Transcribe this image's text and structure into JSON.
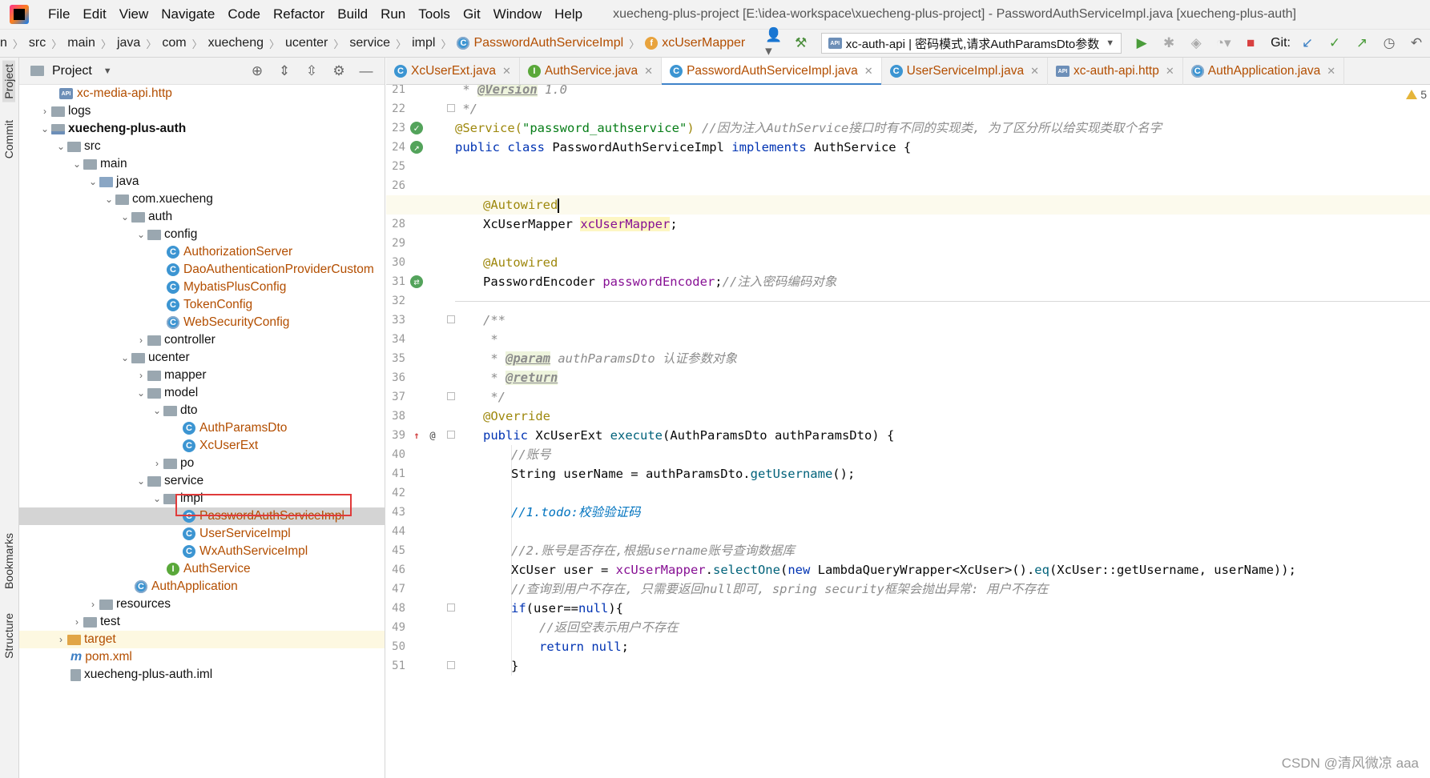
{
  "menubar": {
    "items": [
      "File",
      "Edit",
      "View",
      "Navigate",
      "Code",
      "Refactor",
      "Build",
      "Run",
      "Tools",
      "Git",
      "Window",
      "Help"
    ],
    "title": "xuecheng-plus-project [E:\\idea-workspace\\xuecheng-plus-project] - PasswordAuthServiceImpl.java [xuecheng-plus-auth]"
  },
  "breadcrumb": {
    "items": [
      "n",
      "src",
      "main",
      "java",
      "com",
      "xuecheng",
      "ucenter",
      "service",
      "impl",
      "PasswordAuthServiceImpl",
      "xcUserMapper"
    ]
  },
  "toolbar": {
    "run_config": "xc-auth-api | 密码模式,请求AuthParamsDto参数",
    "git_label": "Git:"
  },
  "toolstrip": {
    "project": "Project",
    "commit": "Commit",
    "bookmarks": "Bookmarks",
    "structure": "Structure"
  },
  "project_panel": {
    "title": "Project",
    "tree": [
      "xc-media-api.http",
      "logs",
      "xuecheng-plus-auth",
      "src",
      "main",
      "java",
      "com.xuecheng",
      "auth",
      "config",
      "AuthorizationServer",
      "DaoAuthenticationProviderCustom",
      "MybatisPlusConfig",
      "TokenConfig",
      "WebSecurityConfig",
      "controller",
      "ucenter",
      "mapper",
      "model",
      "dto",
      "AuthParamsDto",
      "XcUserExt",
      "po",
      "service",
      "impl",
      "PasswordAuthServiceImpl",
      "UserServiceImpl",
      "WxAuthServiceImpl",
      "AuthService",
      "AuthApplication",
      "resources",
      "test",
      "target",
      "pom.xml",
      "xuecheng-plus-auth.iml"
    ]
  },
  "tabs": [
    {
      "label": "XcUserExt.java"
    },
    {
      "label": "AuthService.java"
    },
    {
      "label": "PasswordAuthServiceImpl.java"
    },
    {
      "label": "UserServiceImpl.java"
    },
    {
      "label": "xc-auth-api.http"
    },
    {
      "label": "AuthApplication.java"
    }
  ],
  "editor": {
    "warning_count": "5",
    "line_numbers": [
      "21",
      "22",
      "23",
      "24",
      "25",
      "26",
      "27",
      "28",
      "29",
      "30",
      "31",
      "32",
      "33",
      "34",
      "35",
      "36",
      "37",
      "38",
      "39",
      "40",
      "41",
      "42",
      "43",
      "44",
      "45",
      "46",
      "47",
      "48",
      "49",
      "50",
      "51"
    ],
    "code": {
      "l21_star": " * ",
      "l21_tag": "@Version",
      "l21_rest": " 1.0",
      "l22": " */",
      "l23_ann": "@Service(",
      "l23_str": "\"password_authservice\"",
      "l23_close": ") ",
      "l23_cm": "//因为注入AuthService接口时有不同的实现类, 为了区分所以给实现类取个名字",
      "l24_kw1": "public class ",
      "l24_name": "PasswordAuthServiceImpl ",
      "l24_kw2": "implements ",
      "l24_rest": "AuthService {",
      "l27_ann": "@Autowired",
      "l28_type": "XcUserMapper ",
      "l28_field": "xcUserMapper",
      "l28_end": ";",
      "l30_ann": "@Autowired",
      "l31_type": "PasswordEncoder ",
      "l31_field": "passwordEncoder",
      "l31_end": ";",
      "l31_cm": "//注入密码编码对象",
      "l33": "/**",
      "l34": " *",
      "l35_star": " * ",
      "l35_tag": "@param",
      "l35_rest": " authParamsDto 认证参数对象",
      "l36_star": " * ",
      "l36_tag": "@return",
      "l37": " */",
      "l38": "@Override",
      "l39_kw": "public ",
      "l39_type": "XcUserExt ",
      "l39_meth": "execute",
      "l39_rest": "(AuthParamsDto authParamsDto) {",
      "l40": "//账号",
      "l41_a": "String userName = authParamsDto.",
      "l41_m": "getUsername",
      "l41_b": "();",
      "l43": "//1.todo:校验验证码",
      "l45": "//2.账号是否存在,根据username账号查询数据库",
      "l46_a": "XcUser user = ",
      "l46_f": "xcUserMapper",
      "l46_b": ".",
      "l46_m": "selectOne",
      "l46_c": "(",
      "l46_kw": "new ",
      "l46_d": "LambdaQueryWrapper<XcUser>().",
      "l46_m2": "eq",
      "l46_e": "(XcUser::getUsername, userName));",
      "l47": "//查询到用户不存在, 只需要返回null即可, spring security框架会抛出异常: 用户不存在",
      "l48_kw": "if",
      "l48_a": "(user==",
      "l48_kw2": "null",
      "l48_b": "){",
      "l49": "//返回空表示用户不存在",
      "l50_kw": "return null",
      "l50_b": ";",
      "l51": "}"
    }
  },
  "watermark": "CSDN @清风微凉 aaa",
  "colors": {
    "accent_tab": "#4083c9",
    "highlight_box": "#e03a3a",
    "class_name": "#b34e00"
  }
}
